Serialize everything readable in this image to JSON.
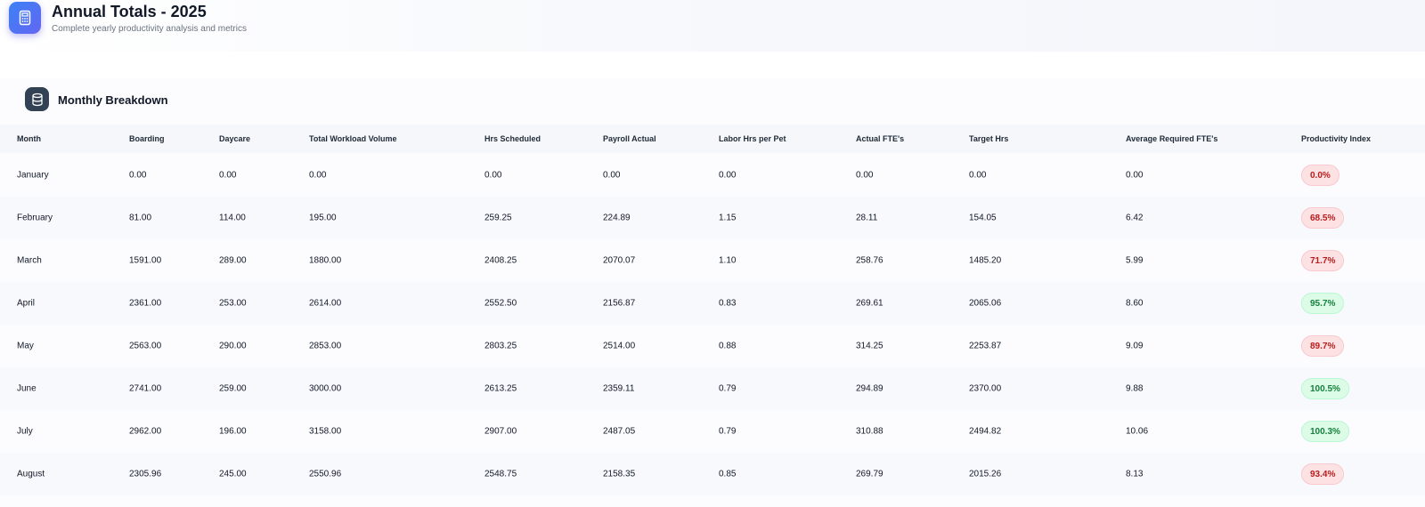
{
  "header": {
    "title": "Annual Totals - 2025",
    "subtitle": "Complete yearly productivity analysis and metrics",
    "icon": "calculator-icon"
  },
  "section": {
    "title": "Monthly Breakdown",
    "icon": "database-icon"
  },
  "colors": {
    "accent": "#4f46e5",
    "good_text": "#15803d",
    "good_bg": "#dcfce7",
    "bad_text": "#b91c1c",
    "bad_bg": "#fde2e4"
  },
  "table": {
    "columns": [
      "Month",
      "Boarding",
      "Daycare",
      "Total Workload Volume",
      "Hrs Scheduled",
      "Payroll Actual",
      "Labor Hrs per Pet",
      "Actual FTE's",
      "Target Hrs",
      "Average Required FTE's",
      "Productivity Index"
    ],
    "rows": [
      {
        "cells": [
          "January",
          "0.00",
          "0.00",
          "0.00",
          "0.00",
          "0.00",
          "0.00",
          "0.00",
          "0.00",
          "0.00"
        ],
        "index": "0.0%",
        "status": "bad"
      },
      {
        "cells": [
          "February",
          "81.00",
          "114.00",
          "195.00",
          "259.25",
          "224.89",
          "1.15",
          "28.11",
          "154.05",
          "6.42"
        ],
        "index": "68.5%",
        "status": "bad"
      },
      {
        "cells": [
          "March",
          "1591.00",
          "289.00",
          "1880.00",
          "2408.25",
          "2070.07",
          "1.10",
          "258.76",
          "1485.20",
          "5.99"
        ],
        "index": "71.7%",
        "status": "bad"
      },
      {
        "cells": [
          "April",
          "2361.00",
          "253.00",
          "2614.00",
          "2552.50",
          "2156.87",
          "0.83",
          "269.61",
          "2065.06",
          "8.60"
        ],
        "index": "95.7%",
        "status": "good"
      },
      {
        "cells": [
          "May",
          "2563.00",
          "290.00",
          "2853.00",
          "2803.25",
          "2514.00",
          "0.88",
          "314.25",
          "2253.87",
          "9.09"
        ],
        "index": "89.7%",
        "status": "bad"
      },
      {
        "cells": [
          "June",
          "2741.00",
          "259.00",
          "3000.00",
          "2613.25",
          "2359.11",
          "0.79",
          "294.89",
          "2370.00",
          "9.88"
        ],
        "index": "100.5%",
        "status": "good"
      },
      {
        "cells": [
          "July",
          "2962.00",
          "196.00",
          "3158.00",
          "2907.00",
          "2487.05",
          "0.79",
          "310.88",
          "2494.82",
          "10.06"
        ],
        "index": "100.3%",
        "status": "good"
      },
      {
        "cells": [
          "August",
          "2305.96",
          "245.00",
          "2550.96",
          "2548.75",
          "2158.35",
          "0.85",
          "269.79",
          "2015.26",
          "8.13"
        ],
        "index": "93.4%",
        "status": "bad"
      }
    ]
  }
}
